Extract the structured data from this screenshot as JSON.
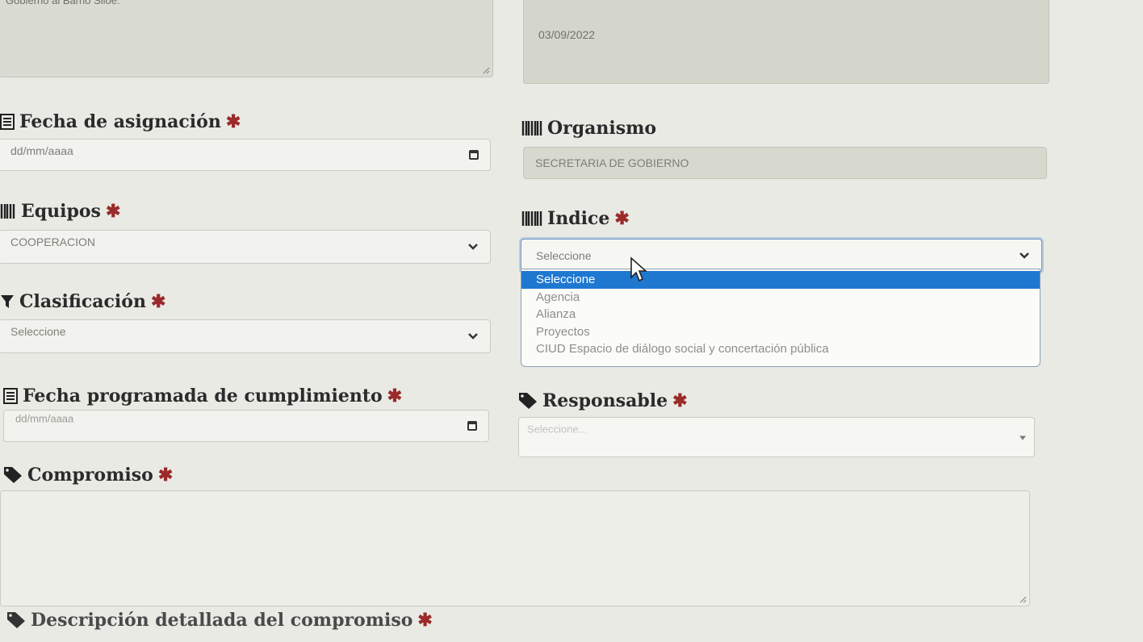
{
  "top": {
    "left_textarea_value": "Gobierno al Barrio Siloé.",
    "right_date_value": "03/09/2022"
  },
  "fields": {
    "fecha_asignacion": {
      "label": "Fecha de asignación",
      "placeholder": "dd/mm/aaaa"
    },
    "organismo": {
      "label": "Organismo",
      "value": "SECRETARIA DE GOBIERNO"
    },
    "equipos": {
      "label": "Equipos",
      "value": "COOPERACION"
    },
    "indice": {
      "label": "Indice",
      "value": "Seleccione",
      "options": [
        "Seleccione",
        "Agencia",
        "Alianza",
        "Proyectos",
        "CIUD Espacio de diálogo social y concertación pública"
      ]
    },
    "clasificacion": {
      "label": "Clasificación",
      "value": "Seleccione"
    },
    "fecha_cumplimiento": {
      "label": "Fecha programada de cumplimiento",
      "placeholder": "dd/mm/aaaa"
    },
    "responsable": {
      "label": "Responsable",
      "placeholder": "Seleccione..."
    },
    "compromiso": {
      "label": "Compromiso"
    },
    "descripcion": {
      "label": "Descripción detallada del compromiso"
    }
  },
  "required_mark": "✱",
  "icons": {
    "date": "calendar-list-icon",
    "barcode": "barcode-icon",
    "filter": "filter-icon",
    "tag": "tag-icon"
  },
  "colors": {
    "required": "#9b2a2a",
    "highlight": "#1e78d0"
  }
}
